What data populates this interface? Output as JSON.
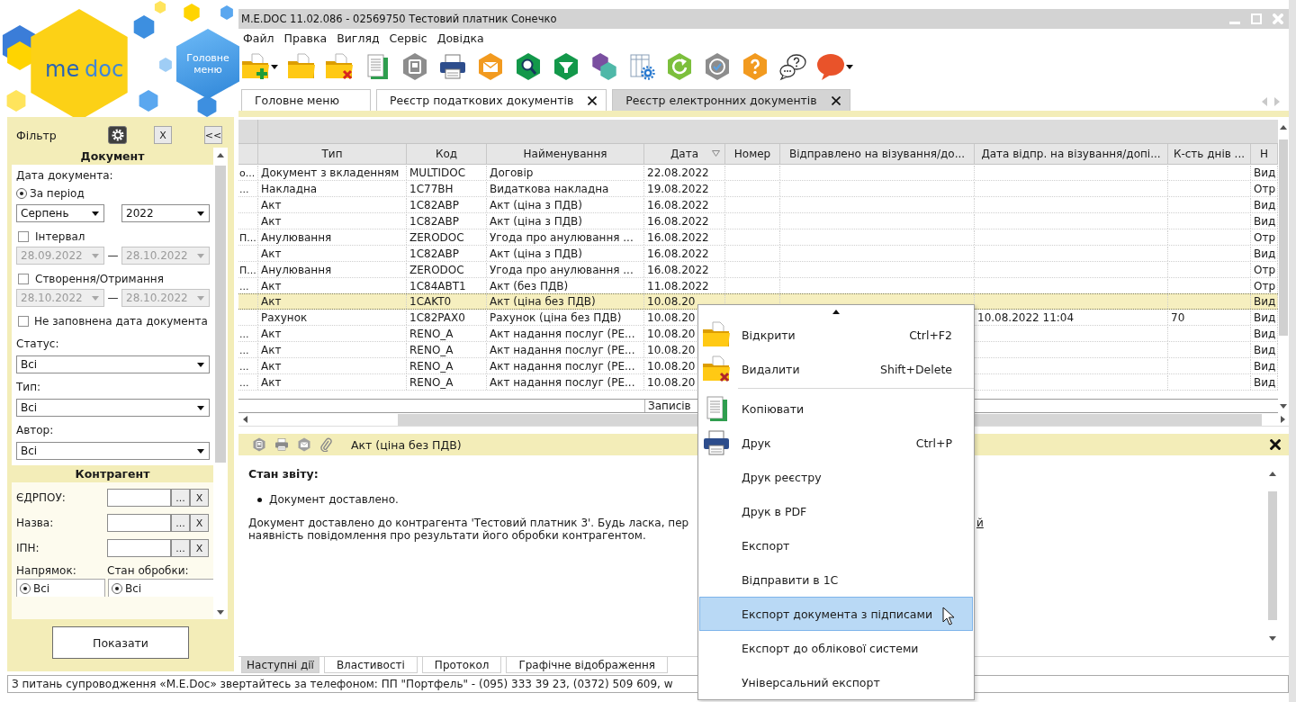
{
  "window": {
    "title": "M.E.DOC 11.02.086 - 02569750 Тестовий платник Сонечко"
  },
  "logo": {
    "parts": [
      "me",
      "doc"
    ]
  },
  "main_menu_button": "Головне меню",
  "menu": [
    "Файл",
    "Правка",
    "Вигляд",
    "Сервіс",
    "Довідка"
  ],
  "tabs": [
    {
      "label": "Головне меню",
      "selected": false,
      "closable": false
    },
    {
      "label": "Реєстр податкових документів",
      "selected": false,
      "closable": true
    },
    {
      "label": "Реєстр електронних документів",
      "selected": true,
      "closable": true
    }
  ],
  "filter": {
    "title": "Фільтр",
    "close_button": "X",
    "collapse_button": "<<",
    "document": {
      "title": "Документ",
      "date_label": "Дата документа:",
      "period": {
        "label": "За період",
        "selected": true,
        "month": "Серпень",
        "year": "2022"
      },
      "ranges": [
        {
          "label": "Інтервал",
          "checked": false,
          "from": "28.09.2022",
          "dash": "—",
          "to": "28.10.2022"
        },
        {
          "label": "Створення/Отримання",
          "checked": false,
          "from": "28.10.2022",
          "dash": "—",
          "to": "28.10.2022"
        }
      ],
      "empty_date": {
        "label": "Не заповнена дата документа",
        "checked": false
      },
      "selects": [
        {
          "label": "Статус:",
          "value": "Всі"
        },
        {
          "label": "Тип:",
          "value": "Всі"
        },
        {
          "label": "Автор:",
          "value": "Всі"
        }
      ]
    },
    "counterparty": {
      "title": "Контрагент",
      "fields": [
        {
          "label": "ЄДРПОУ:",
          "browse": "...",
          "clear": "X"
        },
        {
          "label": "Назва:",
          "browse": "...",
          "clear": "X"
        },
        {
          "label": "ІПН:",
          "browse": "...",
          "clear": "X"
        }
      ],
      "choices": [
        {
          "label": "Напрямок:",
          "option": "Всі",
          "selected": true
        },
        {
          "label": "Стан обробки:",
          "option": "Всі",
          "selected": true
        }
      ]
    },
    "show_button": "Показати"
  },
  "table": {
    "columns": [
      {
        "label": "Тип",
        "sorted": false
      },
      {
        "label": "Код",
        "sorted": false
      },
      {
        "label": "Найменування",
        "sorted": false
      },
      {
        "label": "Дата",
        "sorted": true
      },
      {
        "label": "Номер",
        "sorted": false
      },
      {
        "label": "Відправлено на візування/до...",
        "sorted": false
      },
      {
        "label": "Дата відпр. на візування/допі...",
        "sorted": false
      },
      {
        "label": "К-сть днів ...",
        "sorted": false
      },
      {
        "label": "Н",
        "sorted": false
      }
    ],
    "rows": [
      {
        "column_1": "о...",
        "type": "Документ з вкладенням",
        "code": "MULTIDOC",
        "name": "Договір",
        "date": "22.08.2022",
        "column_10": "Вид",
        "selected": false
      },
      {
        "column_1": "...",
        "type": "Накладна",
        "code": "1C77BH",
        "name": "Видаткова накладна",
        "date": "19.08.2022",
        "column_10": "Отр",
        "selected": false
      },
      {
        "type": "Акт",
        "code": "1C82ABP",
        "name": "Акт (ціна з ПДВ)",
        "date": "16.08.2022",
        "column_10": "Вид",
        "selected": false
      },
      {
        "type": "Акт",
        "code": "1C82ABP",
        "name": "Акт (ціна з ПДВ)",
        "date": "16.08.2022",
        "column_10": "Вид",
        "selected": false
      },
      {
        "column_1": "П...",
        "type": "Анулювання",
        "code": "ZERODOC",
        "name": "Угода про анулювання ...",
        "date": "16.08.2022",
        "column_10": "Отр",
        "selected": false
      },
      {
        "type": "Акт",
        "code": "1C82ABP",
        "name": "Акт (ціна з ПДВ)",
        "date": "16.08.2022",
        "column_10": "Вид",
        "selected": false
      },
      {
        "column_1": "П...",
        "type": "Анулювання",
        "code": "ZERODOC",
        "name": "Угода про анулювання ...",
        "date": "16.08.2022",
        "column_10": "Отр",
        "selected": false
      },
      {
        "column_1": "...",
        "type": "Акт",
        "code": "1C84ABT1",
        "name": "Акт (без ПДВ)",
        "date": "11.08.2022",
        "column_10": "Отр",
        "selected": false
      },
      {
        "type": "Акт",
        "code": "1CAKT0",
        "name": "Акт (ціна без ПДВ)",
        "date": "10.08.20",
        "column_10": "Вид",
        "selected": true
      },
      {
        "type": "Рахунок",
        "code": "1C82PAX0",
        "name": "Рахунок (ціна без ПДВ)",
        "date": "10.08.20",
        "sent_date": "10.08.2022 11:04",
        "days_count": "70",
        "column_10": "Вид",
        "selected": false
      },
      {
        "column_1": "...",
        "type": "Акт",
        "code": "RENO_A",
        "name": "Акт надання послуг (РЕ...",
        "date": "10.08.20",
        "column_10": "Вид",
        "selected": false
      },
      {
        "column_1": "...",
        "type": "Акт",
        "code": "RENO_A",
        "name": "Акт надання послуг (РЕ...",
        "date": "10.08.20",
        "column_10": "Вид",
        "selected": false
      },
      {
        "column_1": "...",
        "type": "Акт",
        "code": "RENO_A",
        "name": "Акт надання послуг (РЕ...",
        "date": "10.08.20",
        "column_10": "Вид",
        "selected": false
      },
      {
        "column_1": "...",
        "type": "Акт",
        "code": "RENO_A",
        "name": "Акт надання послуг (РЕ...",
        "date": "10.08.20",
        "column_10": "Вид",
        "selected": false
      }
    ],
    "footer": "Записів"
  },
  "preview": {
    "title": "Акт (ціна без ПДВ)",
    "heading": "Стан звіту:",
    "bullets": [
      "Документ доставлено."
    ],
    "message_lines": [
      "Документ доставлено до контрагента 'Тестовий платник 3'. Будь ласка, пер",
      "наявність повідомлення про результати його обробки контрагентом."
    ],
    "link_fragment": "й"
  },
  "bottom_tabs": [
    {
      "label": "Наступні дії",
      "selected": true
    },
    {
      "label": "Властивості",
      "selected": false
    },
    {
      "label": "Протокол",
      "selected": false
    },
    {
      "label": "Графічне відображення",
      "selected": false
    }
  ],
  "context_menu": {
    "items": [
      {
        "kind": "item",
        "label": "Відкрити",
        "shortcut": "Ctrl+F2",
        "selected": false
      },
      {
        "kind": "item",
        "label": "Видалити",
        "shortcut": "Shift+Delete",
        "selected": false
      },
      {
        "kind": "separator"
      },
      {
        "kind": "item",
        "label": "Копіювати",
        "selected": false
      },
      {
        "kind": "item",
        "label": "Друк",
        "shortcut": "Ctrl+P",
        "selected": false
      },
      {
        "kind": "item",
        "label": "Друк реєстру",
        "selected": false
      },
      {
        "kind": "item",
        "label": "Друк в PDF",
        "selected": false
      },
      {
        "kind": "item",
        "label": "Експорт",
        "selected": false
      },
      {
        "kind": "item",
        "label": "Відправити в 1С",
        "selected": false
      },
      {
        "kind": "item",
        "label": "Експорт документа з підписами",
        "selected": true
      },
      {
        "kind": "item",
        "label": "Експорт до облікової системи",
        "selected": false
      },
      {
        "kind": "item",
        "label": "Універсальний експорт",
        "selected": false
      }
    ]
  },
  "status_bar": "З питань супроводження «M.E.Doc» звертайтесь за телефоном: ПП \"Портфель\" - (095) 333 39 23, (0372) 509 609, w"
}
